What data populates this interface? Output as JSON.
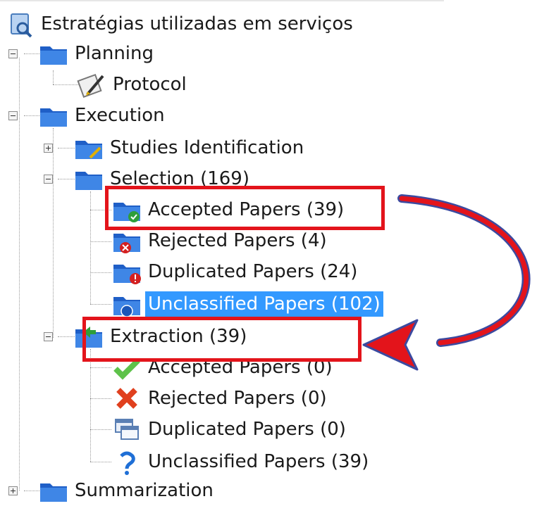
{
  "tree": {
    "root": "Estratégias utilizadas em serviços",
    "planning": "Planning",
    "protocol": "Protocol",
    "execution": "Execution",
    "studies_identification": "Studies Identification",
    "selection": "Selection (169)",
    "sel_accepted": "Accepted Papers (39)",
    "sel_rejected": "Rejected Papers (4)",
    "sel_duplicated": "Duplicated Papers (24)",
    "sel_unclassified": "Unclassified Papers (102)",
    "extraction": "Extraction (39)",
    "ext_accepted": "Accepted Papers (0)",
    "ext_rejected": "Rejected Papers (0)",
    "ext_duplicated": "Duplicated Papers (0)",
    "ext_unclassified": "Unclassified Papers (39)",
    "summarization": "Summarization"
  },
  "colors": {
    "selection_highlight": "#3399ff",
    "annotation_red": "#e3141b",
    "arrow_outline": "#3b4aa0",
    "folder_blue": "#1f5fc7"
  },
  "icons": {
    "root": "review-search-icon",
    "folder": "folder-icon",
    "protocol": "protocol-pen-icon",
    "accepted": "green-check-icon",
    "rejected": "red-x-icon",
    "duplicated": "duplicate-windows-icon",
    "unclassified": "blue-question-icon"
  }
}
